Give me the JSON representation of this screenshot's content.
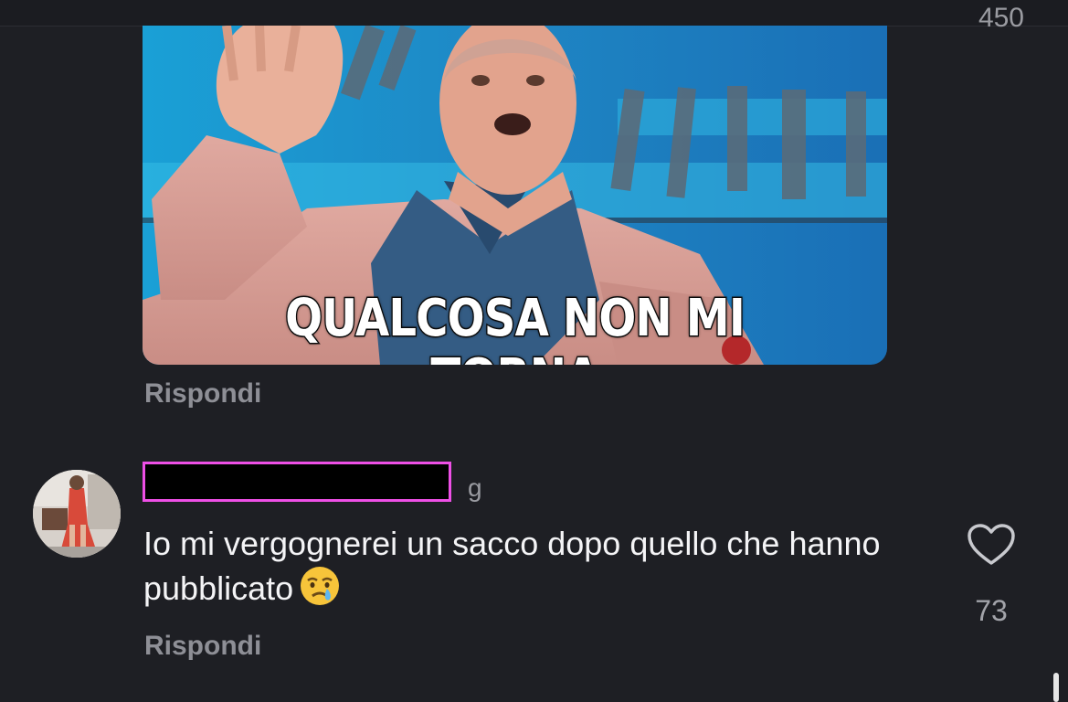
{
  "previous_comment": {
    "like_count_partial": "450",
    "gif_caption": "QUALCOSA NON MI TORNA",
    "reply_label": "Rispondi"
  },
  "comment": {
    "time_ago": "g",
    "text": "Io mi vergognerei un sacco dopo quello che hanno pubblicato",
    "emoji_icon": "crying-face-icon",
    "like_count": "73",
    "reply_label": "Rispondi",
    "username_redaction_color": "#ee4fe6"
  },
  "colors": {
    "background": "#1e1f24",
    "secondary_text": "#8e8f96"
  }
}
